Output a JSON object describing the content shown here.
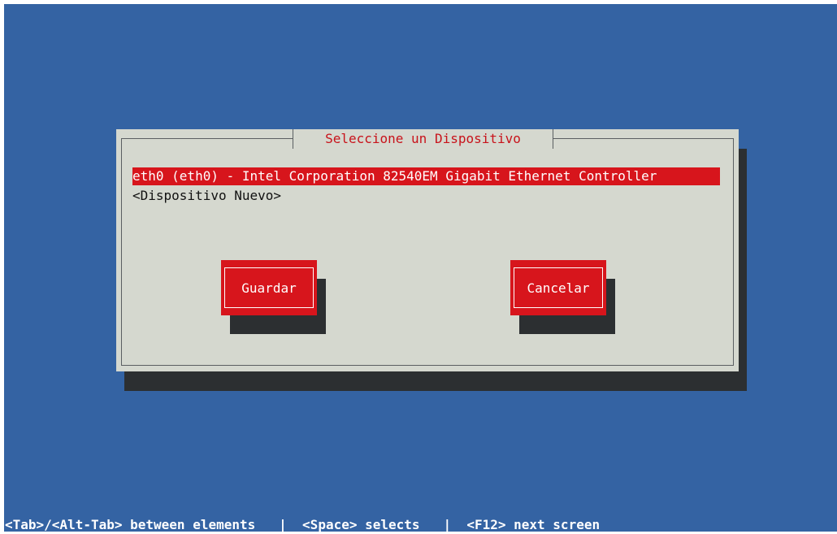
{
  "dialog": {
    "title": "Seleccione un Dispositivo",
    "items": [
      {
        "label": "eth0 (eth0) - Intel Corporation 82540EM Gigabit Ethernet Controller",
        "selected": true
      },
      {
        "label": "<Dispositivo Nuevo>",
        "selected": false
      }
    ],
    "buttons": {
      "save": "Guardar",
      "cancel": "Cancelar"
    }
  },
  "footer": {
    "help": "<Tab>/<Alt-Tab> between elements   |  <Space> selects   |  <F12> next screen"
  },
  "colors": {
    "background": "#3463a3",
    "dialog": "#d5d8cf",
    "accent_red": "#d7151c",
    "shadow": "#2c2f31",
    "title_text": "#c8131b"
  }
}
